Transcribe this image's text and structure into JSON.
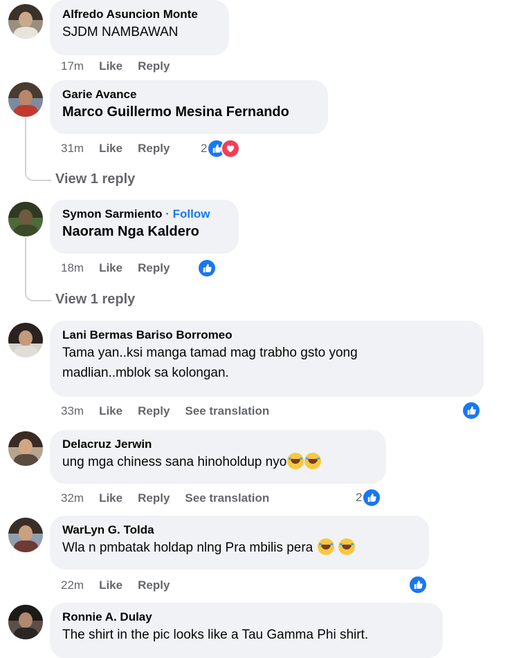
{
  "comments": [
    {
      "name": "Alfredo Asuncion Monte",
      "text": "SJDM NAMBAWAN",
      "time": "17m",
      "like": "Like",
      "reply": "Reply"
    },
    {
      "name": "Garie Avance",
      "text": "Marco Guillermo Mesina Fernando",
      "time": "31m",
      "like": "Like",
      "reply": "Reply",
      "reaction_count": "2",
      "view_reply": "View 1 reply"
    },
    {
      "name": "Symon Sarmiento",
      "follow": "Follow",
      "text": "Naoram Nga Kaldero",
      "time": "18m",
      "like": "Like",
      "reply": "Reply",
      "view_reply": "View 1 reply"
    },
    {
      "name": "Lani Bermas Bariso Borromeo",
      "text_line1": "Tama yan..ksi manga tamad mag trabho gsto yong",
      "text_line2": "madlian..mblok sa kolongan.",
      "time": "33m",
      "like": "Like",
      "reply": "Reply",
      "translate": "See translation"
    },
    {
      "name": "Delacruz Jerwin",
      "text": "ung mga chiness sana hinoholdup nyo",
      "time": "32m",
      "like": "Like",
      "reply": "Reply",
      "translate": "See translation",
      "reaction_count": "2"
    },
    {
      "name": "WarLyn G. Tolda",
      "text": "Wla n pmbatak holdap nlng Pra mbilis pera",
      "time": "22m",
      "like": "Like",
      "reply": "Reply"
    },
    {
      "name": "Ronnie A. Dulay",
      "text": "The shirt in the pic looks like a Tau Gamma Phi shirt."
    }
  ],
  "icons": {
    "like": "thumbs-up-icon",
    "love": "heart-icon",
    "emoji": "laughing-tears-emoji"
  },
  "colors": {
    "accent": "#1877f2",
    "love": "#f33e58",
    "bubble": "#f0f2f5",
    "meta": "#65676b"
  }
}
